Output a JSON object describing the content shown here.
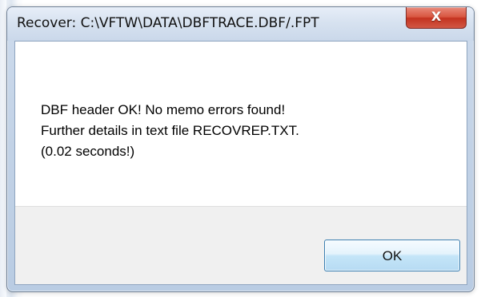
{
  "dialog": {
    "title": "Recover: C:\\VFTW\\DATA\\DBFTRACE.DBF/.FPT",
    "close_label": "X",
    "message_lines": [
      "DBF header OK!  No memo errors found!",
      "Further details in text file RECOVREP.TXT.",
      "(0.02 seconds!)"
    ],
    "ok_label": "OK"
  },
  "icons": {
    "close": "close-icon"
  },
  "colors": {
    "title_bar": "#d7e2f0",
    "close_button": "#d8553f",
    "dialog_body": "#ffffff",
    "button_area": "#f0f0f0",
    "ok_button_border": "#3c7fb1"
  }
}
